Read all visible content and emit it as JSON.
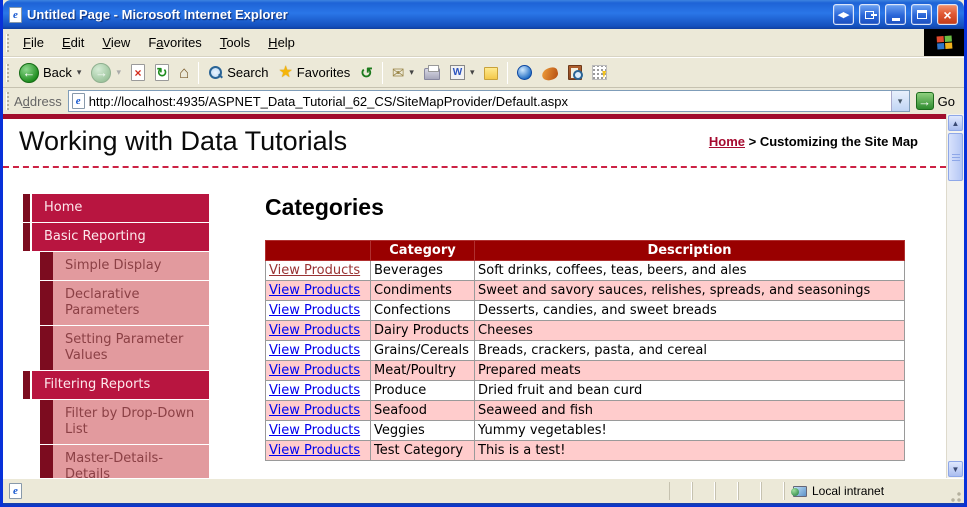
{
  "window": {
    "title": "Untitled Page - Microsoft Internet Explorer"
  },
  "menu": {
    "items": [
      {
        "pre": "",
        "key": "F",
        "post": "ile"
      },
      {
        "pre": "",
        "key": "E",
        "post": "dit"
      },
      {
        "pre": "",
        "key": "V",
        "post": "iew"
      },
      {
        "pre": "F",
        "key": "a",
        "post": "vorites"
      },
      {
        "pre": "",
        "key": "T",
        "post": "ools"
      },
      {
        "pre": "",
        "key": "H",
        "post": "elp"
      }
    ]
  },
  "toolbar": {
    "back_label": "Back",
    "search_label": "Search",
    "favorites_label": "Favorites"
  },
  "address": {
    "label": {
      "pre": "A",
      "key": "d",
      "post": "dress"
    },
    "url": "http://localhost:4935/ASPNET_Data_Tutorial_62_CS/SiteMapProvider/Default.aspx",
    "go_label": "Go"
  },
  "page": {
    "site_title": "Working with Data Tutorials",
    "breadcrumb": {
      "home": "Home",
      "separator": " > ",
      "current": "Customizing the Site Map"
    },
    "sidebar": [
      {
        "label": "Home"
      },
      {
        "label": "Basic Reporting"
      },
      {
        "label": "Simple Display"
      },
      {
        "label": "Declarative Parameters"
      },
      {
        "label": "Setting Parameter Values"
      },
      {
        "label": "Filtering Reports"
      },
      {
        "label": "Filter by Drop-Down List"
      },
      {
        "label": "Master-Details-Details"
      }
    ],
    "main": {
      "heading": "Categories",
      "table": {
        "link_label": "View Products",
        "headers": {
          "category": "Category",
          "description": "Description"
        },
        "rows": [
          {
            "category": "Beverages",
            "description": "Soft drinks, coffees, teas, beers, and ales"
          },
          {
            "category": "Condiments",
            "description": "Sweet and savory sauces, relishes, spreads, and seasonings"
          },
          {
            "category": "Confections",
            "description": "Desserts, candies, and sweet breads"
          },
          {
            "category": "Dairy Products",
            "description": "Cheeses"
          },
          {
            "category": "Grains/Cereals",
            "description": "Breads, crackers, pasta, and cereal"
          },
          {
            "category": "Meat/Poultry",
            "description": "Prepared meats"
          },
          {
            "category": "Produce",
            "description": "Dried fruit and bean curd"
          },
          {
            "category": "Seafood",
            "description": "Seaweed and fish"
          },
          {
            "category": "Veggies",
            "description": "Yummy vegetables!"
          },
          {
            "category": "Test Category",
            "description": "This is a test!"
          }
        ]
      }
    }
  },
  "statusbar": {
    "zone_label": "Local intranet"
  },
  "icons": {
    "ie_logo": "e",
    "back": "←",
    "forward": "→",
    "stop": "×",
    "refresh": "↻",
    "home": "⌂",
    "favorites_star": "★",
    "history": "↺",
    "mail": "✉",
    "word": "W",
    "dropdown": "▾",
    "go_arrow": "→",
    "close": "×",
    "resize_toggle": "◂▸",
    "scroll_up": "▲",
    "scroll_down": "▼"
  },
  "colors": {
    "titlebar_blue": "#2a76e8",
    "frame_blue": "#0831d9",
    "accent_crimson": "#b81540",
    "accent_maroon_strip": "#7c0c1f",
    "submenu_salmon": "#e29a9e",
    "table_header_maroon": "#990000",
    "row_alt_pink": "#ffcccc",
    "link_blue": "#0000ee",
    "link_visited_maroon": "#993333",
    "chrome_tan": "#ece9d8"
  }
}
